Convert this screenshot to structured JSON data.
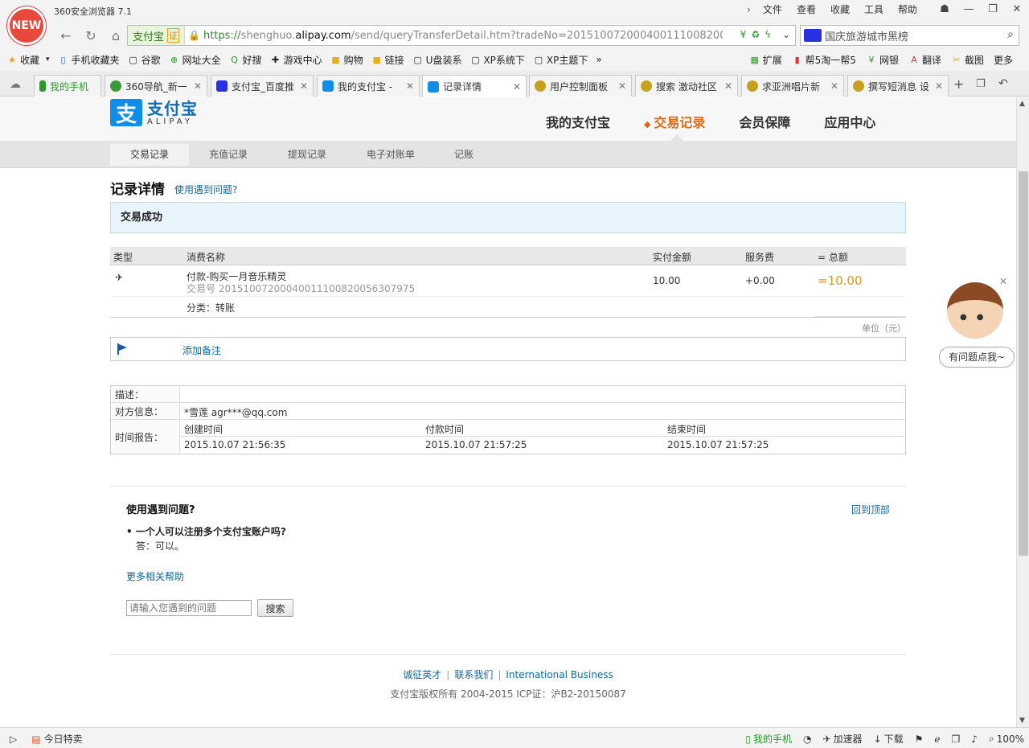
{
  "browser": {
    "app_title": "360安全浏览器 7.1",
    "new_badge": "NEW",
    "menu": [
      "文件",
      "查看",
      "收藏",
      "工具",
      "帮助"
    ],
    "cert_label": "支付宝",
    "cert_badge": "证",
    "url_scheme": "https://",
    "url_sub": "shenghuo.",
    "url_domain": "alipay.com",
    "url_path": "/send/queryTransferDetail.htm?tradeNo=2015100720004001110082005",
    "search_value": "国庆旅游城市黑榜",
    "bookmarks": [
      {
        "label": "收藏",
        "icon": "star-icon"
      },
      {
        "label": "手机收藏夹",
        "icon": "phone-icon"
      },
      {
        "label": "谷歌",
        "icon": "page-icon"
      },
      {
        "label": "网址大全",
        "icon": "plus-circle-icon"
      },
      {
        "label": "好搜",
        "icon": "search-icon"
      },
      {
        "label": "游戏中心",
        "icon": "gamepad-icon"
      },
      {
        "label": "购物",
        "icon": "folder-icon"
      },
      {
        "label": "链接",
        "icon": "folder-icon"
      },
      {
        "label": "U盘装系",
        "icon": "page-icon"
      },
      {
        "label": "XP系统下",
        "icon": "page-icon"
      },
      {
        "label": "XP主题下",
        "icon": "page-icon"
      }
    ],
    "bookmarks_right": [
      "扩展",
      "帮5淘一帮5",
      "网银",
      "翻译",
      "截图",
      "更多"
    ],
    "tabs": [
      {
        "label": "我的手机",
        "color": "#2a9a2a"
      },
      {
        "label": "360导航_新一",
        "color": "#3a9a3a"
      },
      {
        "label": "支付宝_百度推",
        "color": "#2932e1"
      },
      {
        "label": "我的支付宝 -",
        "color": "#0e8ee9"
      },
      {
        "label": "记录详情",
        "color": "#0e8ee9"
      },
      {
        "label": "用户控制面板",
        "color": "#c8a020"
      },
      {
        "label": "搜索 激动社区",
        "color": "#c8a020"
      },
      {
        "label": "求亚洲唱片新",
        "color": "#c8a020"
      },
      {
        "label": "撰写短消息 设",
        "color": "#c8a020"
      }
    ]
  },
  "site": {
    "logo_cn": "支付宝",
    "logo_en": "ALIPAY",
    "logo_mark": "支",
    "nav": [
      "我的支付宝",
      "交易记录",
      "会员保障",
      "应用中心"
    ],
    "subnav": [
      "交易记录",
      "充值记录",
      "提现记录",
      "电子对账单",
      "记账"
    ]
  },
  "detail": {
    "title": "记录详情",
    "help_link": "使用遇到问题?",
    "status": "交易成功",
    "headers": [
      "类型",
      "消费名称",
      "实付金额",
      "服务费",
      "= 总额"
    ],
    "item_name": "付款-购买一月音乐精灵",
    "trade_no": "交易号 2015100720004001110082005630797​5",
    "paid": "10.00",
    "fee": "+0.00",
    "total": "=10.00",
    "category": "分类：转账",
    "unit": "单位（元）",
    "add_memo": "添加备注"
  },
  "info": {
    "desc_label": "描述：",
    "desc_value": "",
    "party_label": "对方信息：",
    "party_value": "*雪莲 agr***@qq.com",
    "time_label": "时间报告：",
    "time_headers": [
      "创建时间",
      "付款时间",
      "结束时间"
    ],
    "time_values": [
      "2015.10.07 21:56:35",
      "2015.10.07 21:57:25",
      "2015.10.07 21:57:25"
    ]
  },
  "help": {
    "title": "使用遇到问题?",
    "back_top": "回到顶部",
    "question": "• 一个人可以注册多个支付宝账户吗?",
    "answer": "答：可以。",
    "more": "更多相关帮助",
    "input_placeholder": "请输入您遇到的问题",
    "search_btn": "搜索"
  },
  "footer": {
    "links": [
      "诚征英才",
      "联系我们",
      "International Business"
    ],
    "copyright": "支付宝版权所有 2004-2015 ICP证：沪B2-20150087"
  },
  "helper": {
    "bubble": "有问题点我~"
  },
  "statusbar": {
    "left": [
      "今日特卖"
    ],
    "right": [
      "我的手机",
      "加速器",
      "下载",
      "100%"
    ]
  }
}
